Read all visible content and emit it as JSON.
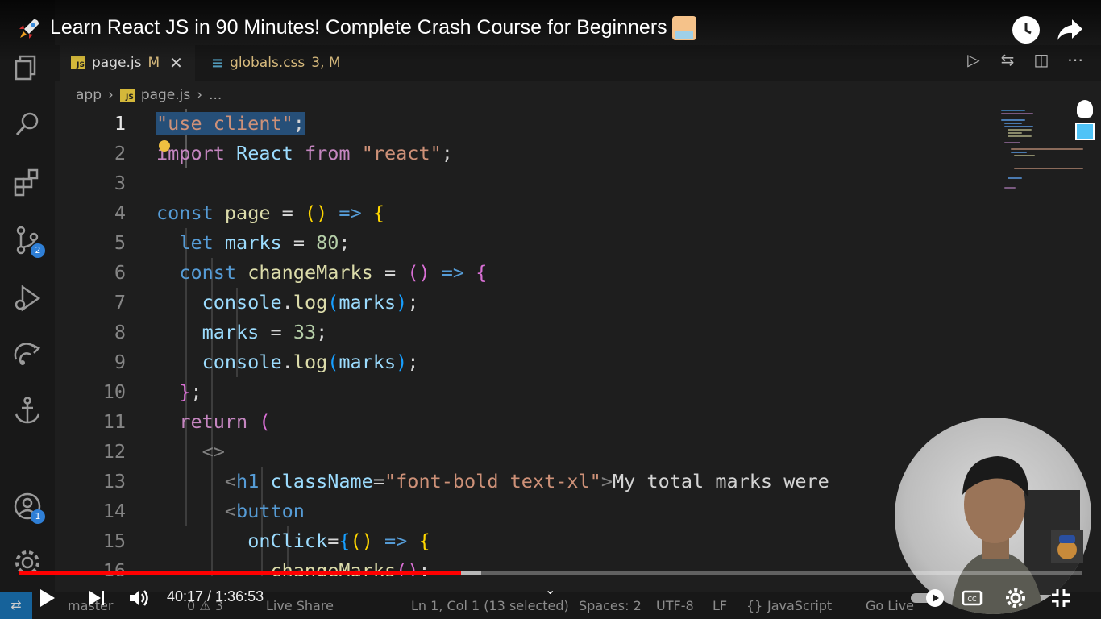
{
  "video": {
    "title": "Learn React JS in 90 Minutes! Complete Crash Course for Beginners",
    "current_time": "40:17",
    "duration": "1:36:53",
    "time_display": "40:17 / 1:36:53",
    "progress_played": 0.4157,
    "progress_buffered": 0.435
  },
  "tabs": [
    {
      "label": "page.js",
      "status": "M",
      "icon": "js-file-icon"
    },
    {
      "label": "globals.css",
      "status": "3, M",
      "icon": "css-file-icon"
    }
  ],
  "breadcrumb": [
    "app",
    "page.js",
    "..."
  ],
  "code": {
    "current_line": 1,
    "lines": [
      "1",
      "2",
      "3",
      "4",
      "5",
      "6",
      "7",
      "8",
      "9",
      "10",
      "11",
      "12",
      "13",
      "14",
      "15",
      "16"
    ]
  },
  "statusbar": {
    "branch": "master",
    "cursor": "Ln 1, Col 1 (13 selected)",
    "spaces": "Spaces: 2",
    "encoding": "UTF-8",
    "eol": "LF",
    "language": "JavaScript",
    "live": "Go Live",
    "live_share": "Live Share",
    "problems": "0 ⚠ 3"
  },
  "colors": {
    "accent_red": "#ff0000",
    "badge_blue": "#2f7fd6",
    "editor_bg": "#1e1e1e"
  },
  "activity_badges": {
    "source_control": "2",
    "accounts": "1"
  }
}
